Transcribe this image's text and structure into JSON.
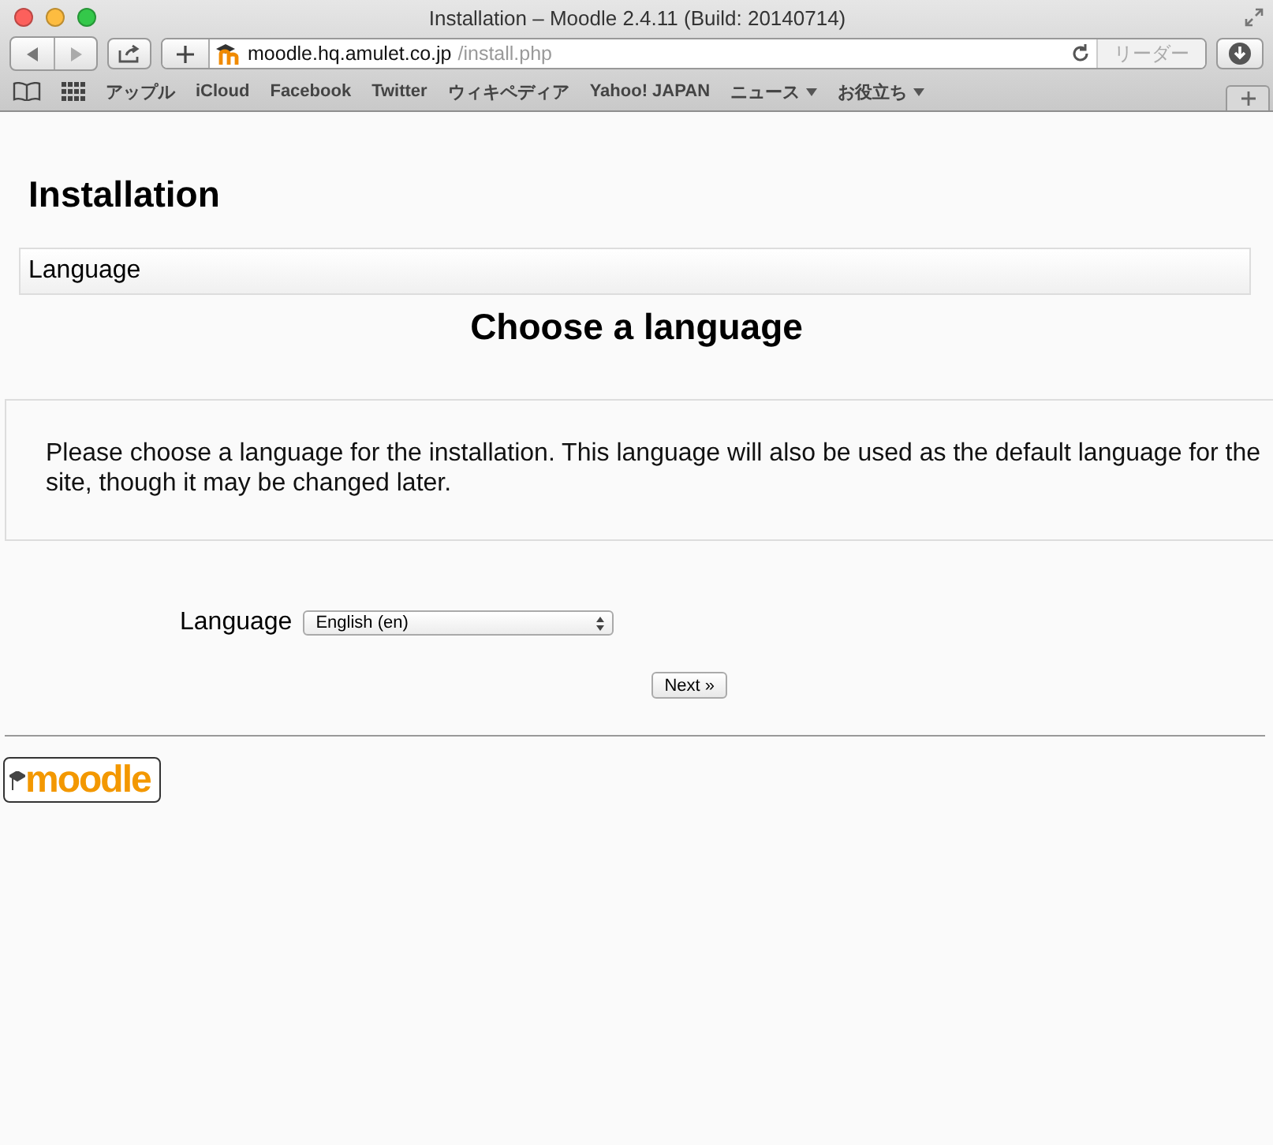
{
  "window": {
    "title": "Installation – Moodle 2.4.11 (Build: 20140714)"
  },
  "toolbar": {
    "url_host": "moodle.hq.amulet.co.jp",
    "url_path": "/install.php",
    "reader_label": "リーダー"
  },
  "bookmarks": [
    {
      "label": "アップル",
      "menu": false
    },
    {
      "label": "iCloud",
      "menu": false
    },
    {
      "label": "Facebook",
      "menu": false
    },
    {
      "label": "Twitter",
      "menu": false
    },
    {
      "label": "ウィキペディア",
      "menu": false
    },
    {
      "label": "Yahoo! JAPAN",
      "menu": false
    },
    {
      "label": "ニュース",
      "menu": true
    },
    {
      "label": "お役立ち",
      "menu": true
    }
  ],
  "page": {
    "heading": "Installation",
    "section_bar": "Language",
    "subheading": "Choose a language",
    "intro": "Please choose a language for the installation. This language will also be used as the default language for the site, though it may be changed later.",
    "field_label": "Language",
    "select_value": "English (en)",
    "next_button": "Next »",
    "logo_text": "moodle"
  }
}
